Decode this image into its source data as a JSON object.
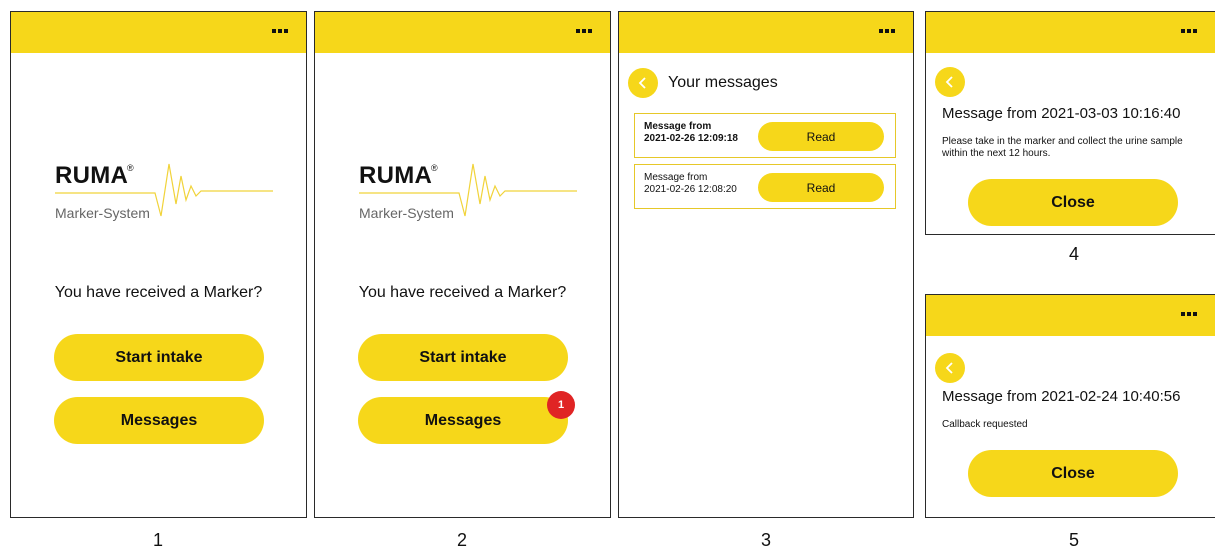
{
  "brand": {
    "name": "RUMA",
    "reg": "®",
    "subtitle": "Marker-System"
  },
  "home": {
    "question": "You have received a Marker?",
    "start_label": "Start intake",
    "messages_label": "Messages",
    "badge_count": "1"
  },
  "inbox": {
    "title": "Your messages",
    "messages": [
      {
        "line1": "Message from",
        "line2": "2021-02-26 12:09:18",
        "unread": true,
        "read_label": "Read"
      },
      {
        "line1": "Message from",
        "line2": "2021-02-26 12:08:20",
        "unread": false,
        "read_label": "Read"
      }
    ]
  },
  "detail1": {
    "title": "Message from 2021-03-03 10:16:40",
    "body": "Please take in the marker and collect the urine sample within the next 12 hours.",
    "close_label": "Close"
  },
  "detail2": {
    "title": "Message from 2021-02-24 10:40:56",
    "body": "Callback requested",
    "close_label": "Close"
  },
  "captions": [
    "1",
    "2",
    "3",
    "4",
    "5"
  ],
  "colors": {
    "accent": "#f6d71a",
    "badge": "#e02424",
    "card_border": "#e6c829"
  },
  "icons": {
    "menu": "more-dots-icon",
    "back": "chevron-left-icon"
  }
}
